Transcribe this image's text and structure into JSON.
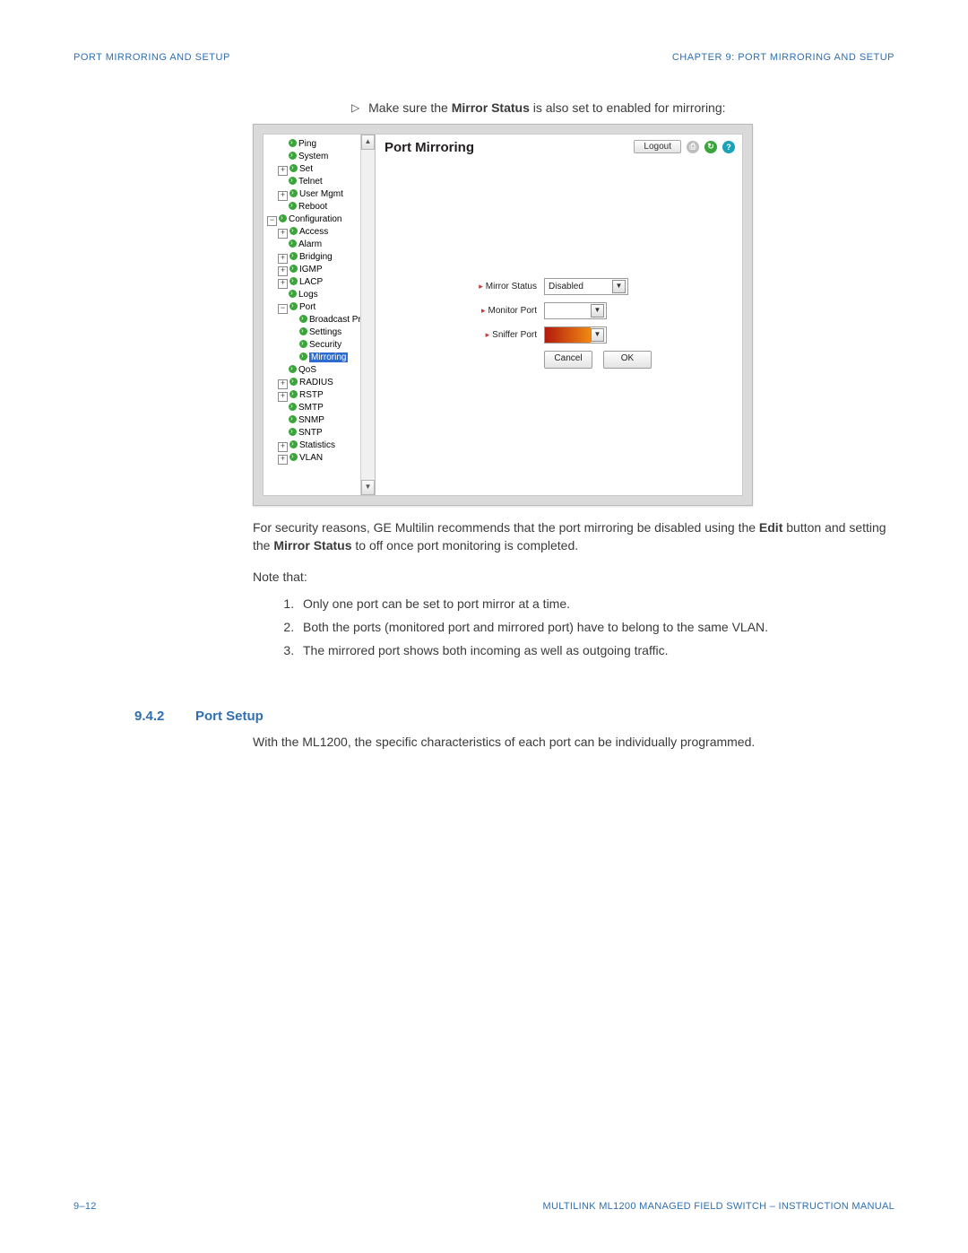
{
  "header": {
    "left": "PORT MIRRORING AND SETUP",
    "right": "CHAPTER 9:  PORT MIRRORING AND SETUP"
  },
  "instruction": {
    "pre": "Make sure the ",
    "bold": "Mirror Status",
    "post": " is also set to enabled for mirroring:"
  },
  "screenshot": {
    "title": "Port Mirroring",
    "logout": "Logout",
    "tree": {
      "ping": "Ping",
      "system": "System",
      "set": "Set",
      "telnet": "Telnet",
      "usermgmt": "User Mgmt",
      "reboot": "Reboot",
      "configuration": "Configuration",
      "access": "Access",
      "alarm": "Alarm",
      "bridging": "Bridging",
      "igmp": "IGMP",
      "lacp": "LACP",
      "logs": "Logs",
      "port": "Port",
      "broadcast": "Broadcast Protect",
      "settings": "Settings",
      "security": "Security",
      "mirroring": "Mirroring",
      "qos": "QoS",
      "radius": "RADIUS",
      "rstp": "RSTP",
      "smtp": "SMTP",
      "snmp": "SNMP",
      "sntp": "SNTP",
      "statistics": "Statistics",
      "vlan": "VLAN"
    },
    "form": {
      "mirror_status_label": "Mirror Status",
      "mirror_status_value": "Disabled",
      "monitor_port_label": "Monitor Port",
      "sniffer_port_label": "Sniffer Port",
      "cancel": "Cancel",
      "ok": "OK"
    }
  },
  "para1_pre": "For security reasons, GE Multilin recommends that the port mirroring be disabled using the ",
  "para1_b1": "Edit",
  "para1_mid": " button and setting the ",
  "para1_b2": "Mirror Status",
  "para1_post": " to off once port monitoring is completed.",
  "note_that": "Note that:",
  "li1": "Only one port can be set to port mirror at a time.",
  "li2": "Both the ports (monitored port and mirrored port) have to belong to the same VLAN.",
  "li3": "The mirrored port shows both incoming as well as outgoing traffic.",
  "section": {
    "num": "9.4.2",
    "title": "Port Setup",
    "body": "With the ML1200, the specific characteristics of each port can be individually programmed."
  },
  "footer": {
    "left": "9–12",
    "right": "MULTILINK ML1200 MANAGED FIELD SWITCH – INSTRUCTION MANUAL"
  }
}
